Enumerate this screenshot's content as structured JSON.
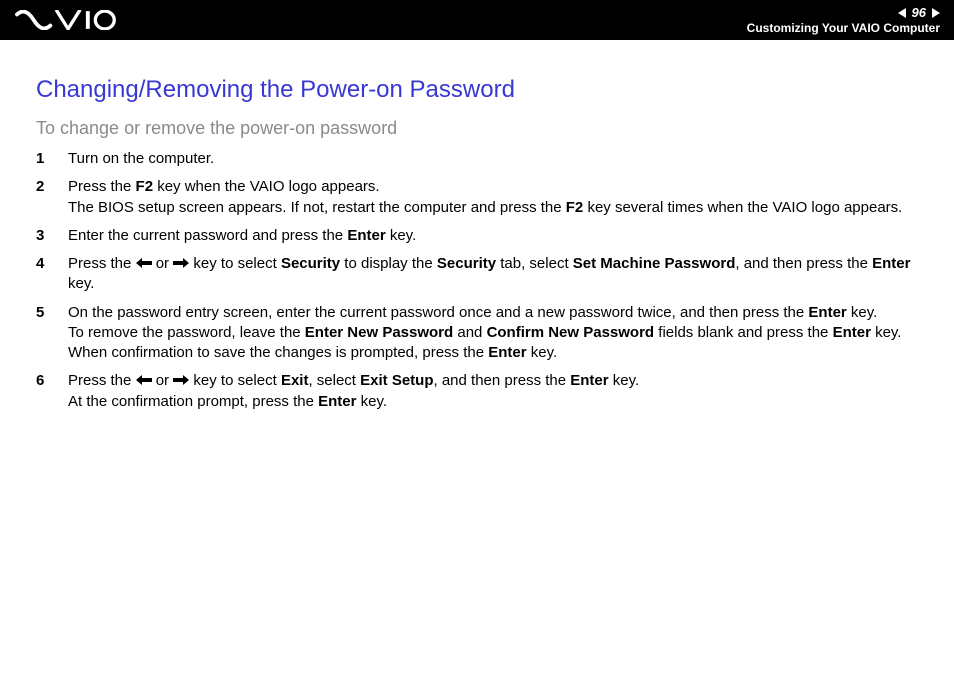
{
  "header": {
    "page_number": "96",
    "section": "Customizing Your VAIO Computer"
  },
  "content": {
    "title": "Changing/Removing the Power-on Password",
    "subtitle": "To change or remove the power-on password",
    "steps": [
      {
        "parts": [
          {
            "t": "Turn on the computer."
          }
        ]
      },
      {
        "parts": [
          {
            "t": "Press the "
          },
          {
            "t": "F2",
            "b": true
          },
          {
            "t": " key when the VAIO logo appears."
          },
          {
            "br": true
          },
          {
            "t": "The BIOS setup screen appears. If not, restart the computer and press the "
          },
          {
            "t": "F2",
            "b": true
          },
          {
            "t": " key several times when the VAIO logo appears."
          }
        ]
      },
      {
        "parts": [
          {
            "t": "Enter the current password and press the "
          },
          {
            "t": "Enter",
            "b": true
          },
          {
            "t": " key."
          }
        ]
      },
      {
        "parts": [
          {
            "t": "Press the "
          },
          {
            "arrow": "left"
          },
          {
            "t": " or "
          },
          {
            "arrow": "right"
          },
          {
            "t": " key to select "
          },
          {
            "t": "Security",
            "b": true
          },
          {
            "t": " to display the "
          },
          {
            "t": "Security",
            "b": true
          },
          {
            "t": " tab, select "
          },
          {
            "t": "Set Machine Password",
            "b": true
          },
          {
            "t": ", and then press the "
          },
          {
            "t": "Enter",
            "b": true
          },
          {
            "t": " key."
          }
        ]
      },
      {
        "parts": [
          {
            "t": "On the password entry screen, enter the current password once and a new password twice, and then press the "
          },
          {
            "t": "Enter",
            "b": true
          },
          {
            "t": " key."
          },
          {
            "br": true
          },
          {
            "t": "To remove the password, leave the "
          },
          {
            "t": "Enter New Password",
            "b": true
          },
          {
            "t": " and "
          },
          {
            "t": "Confirm New Password",
            "b": true
          },
          {
            "t": " fields blank and press the "
          },
          {
            "t": "Enter",
            "b": true
          },
          {
            "t": " key."
          },
          {
            "br": true
          },
          {
            "t": "When confirmation to save the changes is prompted, press the "
          },
          {
            "t": "Enter",
            "b": true
          },
          {
            "t": " key."
          }
        ]
      },
      {
        "parts": [
          {
            "t": "Press the "
          },
          {
            "arrow": "left"
          },
          {
            "t": " or "
          },
          {
            "arrow": "right"
          },
          {
            "t": " key to select "
          },
          {
            "t": "Exit",
            "b": true
          },
          {
            "t": ", select "
          },
          {
            "t": "Exit Setup",
            "b": true
          },
          {
            "t": ", and then press the "
          },
          {
            "t": "Enter",
            "b": true
          },
          {
            "t": " key."
          },
          {
            "br": true
          },
          {
            "t": "At the confirmation prompt, press the "
          },
          {
            "t": "Enter",
            "b": true
          },
          {
            "t": " key."
          }
        ]
      }
    ]
  }
}
